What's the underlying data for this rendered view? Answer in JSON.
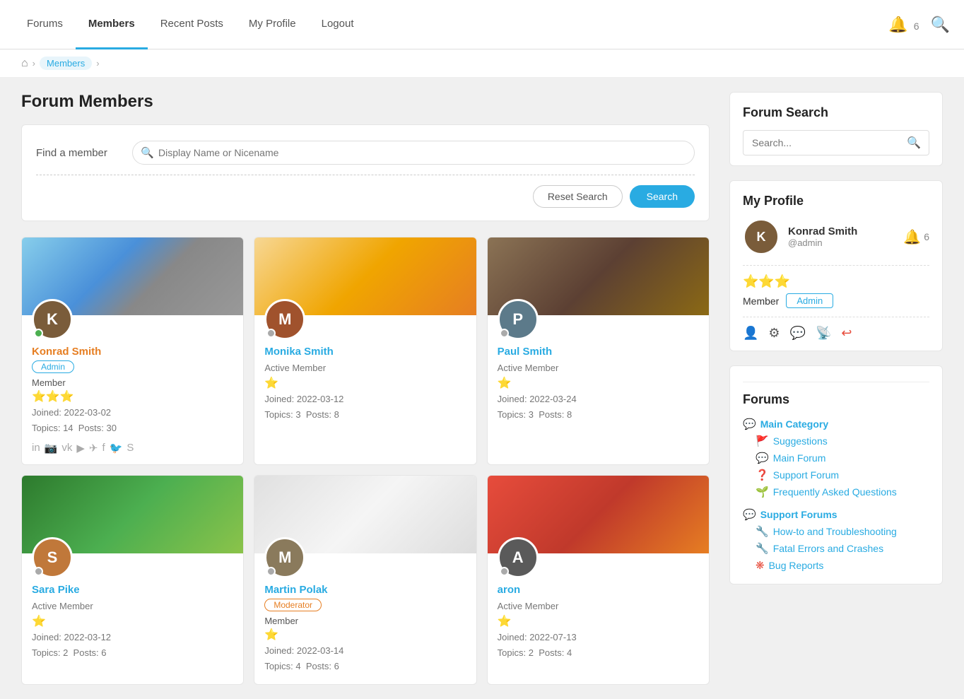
{
  "nav": {
    "items": [
      {
        "label": "Forums",
        "active": false,
        "id": "forums"
      },
      {
        "label": "Members",
        "active": true,
        "id": "members"
      },
      {
        "label": "Recent Posts",
        "active": false,
        "id": "recent-posts"
      },
      {
        "label": "My Profile",
        "active": false,
        "id": "my-profile"
      },
      {
        "label": "Logout",
        "active": false,
        "id": "logout"
      }
    ],
    "notification_count": "6",
    "bell_icon": "🔔",
    "search_icon": "🔍"
  },
  "breadcrumb": {
    "home_icon": "⌂",
    "current": "Members"
  },
  "page": {
    "title": "Forum Members",
    "find_label": "Find a member",
    "search_placeholder": "Display Name or Nicename",
    "reset_label": "Reset Search",
    "search_label": "Search"
  },
  "members": [
    {
      "name": "Konrad Smith",
      "status": "online",
      "role": "Admin",
      "member_type": "Member",
      "stars": 3,
      "joined": "Joined: 2022-03-02",
      "topics": "Topics: 14",
      "posts": "Posts: 30",
      "badge": "Admin",
      "badge_type": "admin",
      "name_color": "orange",
      "banner": "city",
      "initials": "K"
    },
    {
      "name": "Monika Smith",
      "status": "offline",
      "role": "Active Member",
      "member_type": "",
      "stars": 1,
      "joined": "Joined: 2022-03-12",
      "topics": "Topics: 3",
      "posts": "Posts: 8",
      "badge": "",
      "badge_type": "",
      "name_color": "blue",
      "banner": "warm",
      "initials": "M"
    },
    {
      "name": "Paul Smith",
      "status": "offline",
      "role": "Active Member",
      "member_type": "",
      "stars": 1,
      "joined": "Joined: 2022-03-24",
      "topics": "Topics: 3",
      "posts": "Posts: 8",
      "badge": "",
      "badge_type": "",
      "name_color": "blue",
      "banner": "desk",
      "initials": "P"
    },
    {
      "name": "Sara Pike",
      "status": "offline",
      "role": "Active Member",
      "member_type": "",
      "stars": 1,
      "joined": "Joined: 2022-03-12",
      "topics": "Topics: 2",
      "posts": "Posts: 6",
      "badge": "",
      "badge_type": "",
      "name_color": "blue",
      "banner": "green",
      "initials": "S"
    },
    {
      "name": "Martin Polak",
      "status": "offline",
      "role": "Moderator",
      "member_type": "Member",
      "stars": 1,
      "joined": "Joined: 2022-03-14",
      "topics": "Topics: 4",
      "posts": "Posts: 6",
      "badge": "Moderator",
      "badge_type": "moderator",
      "name_color": "blue",
      "banner": "light",
      "initials": "M"
    },
    {
      "name": "aron",
      "status": "offline",
      "role": "Active Member",
      "member_type": "",
      "stars": 1,
      "joined": "Joined: 2022-07-13",
      "topics": "Topics: 2",
      "posts": "Posts: 4",
      "badge": "",
      "badge_type": "",
      "name_color": "blue",
      "banner": "red",
      "initials": "A"
    }
  ],
  "sidebar": {
    "forum_search": {
      "title": "Forum Search",
      "placeholder": "Search..."
    },
    "my_profile": {
      "title": "My Profile",
      "name": "Konrad Smith",
      "username": "@admin",
      "notification_count": "6",
      "stars": 3,
      "role": "Member",
      "badge": "Admin",
      "actions": [
        "person",
        "gear",
        "chat",
        "rss",
        "exit"
      ]
    },
    "forums": {
      "title": "Forums",
      "categories": [
        {
          "label": "Main Category",
          "icon": "💬",
          "icon_color": "blue",
          "items": [
            {
              "label": "Suggestions",
              "icon": "🚩",
              "icon_color": "blue"
            },
            {
              "label": "Main Forum",
              "icon": "💬",
              "icon_color": "blue"
            },
            {
              "label": "Support Forum",
              "icon": "❓",
              "icon_color": "orange"
            },
            {
              "label": "Frequently Asked Questions",
              "icon": "🌱",
              "icon_color": "green"
            }
          ]
        },
        {
          "label": "Support Forums",
          "icon": "💬",
          "icon_color": "blue",
          "items": [
            {
              "label": "How-to and Troubleshooting",
              "icon": "🔧",
              "icon_color": "blue"
            },
            {
              "label": "Fatal Errors and Crashes",
              "icon": "🔧",
              "icon_color": "blue"
            },
            {
              "label": "Bug Reports",
              "icon": "❋",
              "icon_color": "red"
            }
          ]
        }
      ]
    }
  }
}
